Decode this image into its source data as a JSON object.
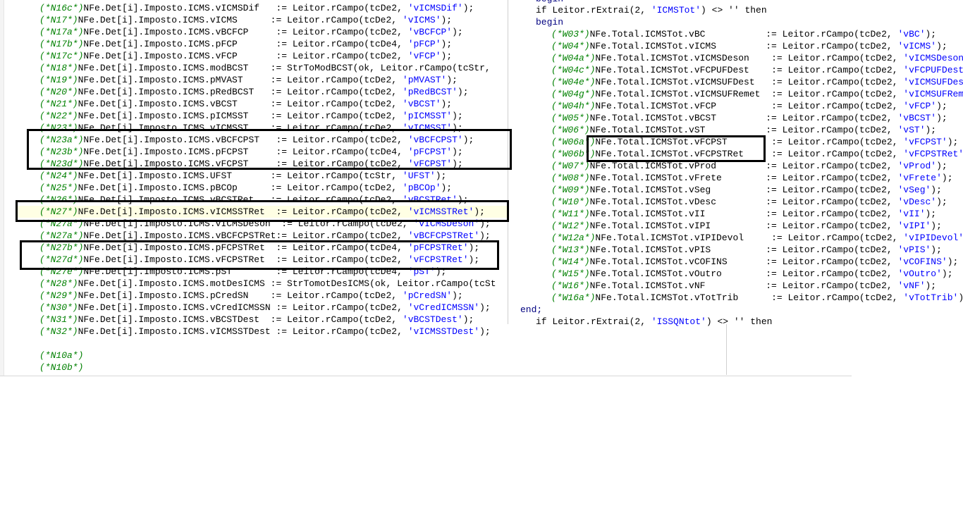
{
  "left_editor": {
    "lines": [
      {
        "t": 3,
        "c": "(*N16c*)",
        "p": "NFe.Det[i].Imposto.ICMS.vICMSDif   := Leitor.rCampo(tcDe2, ",
        "s": "'vICMSDif'",
        "e": ");"
      },
      {
        "t": 20,
        "c": "(*N17*)",
        "p": "NFe.Det[i].Imposto.ICMS.vICMS      := Leitor.rCampo(tcDe2, ",
        "s": "'vICMS'",
        "e": ");"
      },
      {
        "t": 37,
        "c": "(*N17a*)",
        "p": "NFe.Det[i].Imposto.ICMS.vBCFCP     := Leitor.rCampo(tcDe2, ",
        "s": "'vBCFCP'",
        "e": ");"
      },
      {
        "t": 54,
        "c": "(*N17b*)",
        "p": "NFe.Det[i].Imposto.ICMS.pFCP       := Leitor.rCampo(tcDe4, ",
        "s": "'pFCP'",
        "e": ");"
      },
      {
        "t": 71,
        "c": "(*N17c*)",
        "p": "NFe.Det[i].Imposto.ICMS.vFCP       := Leitor.rCampo(tcDe2, ",
        "s": "'vFCP'",
        "e": ");"
      },
      {
        "t": 88,
        "c": "(*N18*)",
        "p": "NFe.Det[i].Imposto.ICMS.modBCST    := StrToModBCST(ok, Leitor.rCampo(tcStr,",
        "s": "",
        "e": ""
      },
      {
        "t": 105,
        "c": "(*N19*)",
        "p": "NFe.Det[i].Imposto.ICMS.pMVAST     := Leitor.rCampo(tcDe2, ",
        "s": "'pMVAST'",
        "e": ");"
      },
      {
        "t": 122,
        "c": "(*N20*)",
        "p": "NFe.Det[i].Imposto.ICMS.pRedBCST   := Leitor.rCampo(tcDe2, ",
        "s": "'pRedBCST'",
        "e": ");"
      },
      {
        "t": 139,
        "c": "(*N21*)",
        "p": "NFe.Det[i].Imposto.ICMS.vBCST      := Leitor.rCampo(tcDe2, ",
        "s": "'vBCST'",
        "e": ");"
      },
      {
        "t": 156,
        "c": "(*N22*)",
        "p": "NFe.Det[i].Imposto.ICMS.pICMSST    := Leitor.rCampo(tcDe2, ",
        "s": "'pICMSST'",
        "e": ");"
      },
      {
        "t": 173,
        "c": "(*N23*)",
        "p": "NFe.Det[i].Imposto.ICMS.vICMSST    := Leitor.rCampo(tcDe2, ",
        "s": "'vICMSST'",
        "e": ");"
      },
      {
        "t": 190,
        "c": "(*N23a*)",
        "p": "NFe.Det[i].Imposto.ICMS.vBCFCPST   := Leitor.rCampo(tcDe2, ",
        "s": "'vBCFCPST'",
        "e": ");"
      },
      {
        "t": 207,
        "c": "(*N23b*)",
        "p": "NFe.Det[i].Imposto.ICMS.pFCPST     := Leitor.rCampo(tcDe4, ",
        "s": "'pFCPST'",
        "e": ");"
      },
      {
        "t": 224,
        "c": "(*N23d*)",
        "p": "NFe.Det[i].Imposto.ICMS.vFCPST     := Leitor.rCampo(tcDe2, ",
        "s": "'vFCPST'",
        "e": ");"
      },
      {
        "t": 241,
        "c": "(*N24*)",
        "p": "NFe.Det[i].Imposto.ICMS.UFST       := Leitor.rCampo(tcStr, ",
        "s": "'UFST'",
        "e": ");"
      },
      {
        "t": 258,
        "c": "(*N25*)",
        "p": "NFe.Det[i].Imposto.ICMS.pBCOp      := Leitor.rCampo(tcDe2, ",
        "s": "'pBCOp'",
        "e": ");"
      },
      {
        "t": 275,
        "c": "(*N26*)",
        "p": "NFe.Det[i].Imposto.ICMS.vBCSTRet   := Leitor.rCampo(tcDe2, ",
        "s": "'vBCSTRet'",
        "e": ");"
      },
      {
        "t": 292,
        "c": "(*N27*)",
        "p": "NFe.Det[i].Imposto.ICMS.vICMSSTRet  := Leitor.rCampo(tcDe2, ",
        "s": "'vICMSSTRet'",
        "e": ");",
        "hl": true
      },
      {
        "t": 309,
        "c": "(*N27a*)",
        "p": "NFe.Det[i].Imposto.ICMS.vICMSDeson  := Leitor.rCampo(tcDe2, ",
        "s": "'vICMSDeson'",
        "e": ");"
      },
      {
        "t": 326,
        "c": "(*N27a*)",
        "p": "NFe.Det[i].Imposto.ICMS.vBCFCPSTRet:= Leitor.rCampo(tcDe2, ",
        "s": "'vBCFCPSTRet'",
        "e": ");"
      },
      {
        "t": 343,
        "c": "(*N27b*)",
        "p": "NFe.Det[i].Imposto.ICMS.pFCPSTRet  := Leitor.rCampo(tcDe4, ",
        "s": "'pFCPSTRet'",
        "e": ");"
      },
      {
        "t": 360,
        "c": "(*N27d*)",
        "p": "NFe.Det[i].Imposto.ICMS.vFCPSTRet  := Leitor.rCampo(tcDe2, ",
        "s": "'vFCPSTRet'",
        "e": ");"
      },
      {
        "t": 377,
        "c": "(*N27e*)",
        "p": "NFe.Det[i].Imposto.ICMS.pST        := Leitor.rCampo(tcDe4, ",
        "s": "'pST'",
        "e": ");"
      },
      {
        "t": 394,
        "c": "(*N28*)",
        "p": "NFe.Det[i].Imposto.ICMS.motDesICMS := StrTomotDesICMS(ok, Leitor.rCampo(tcSt",
        "s": "",
        "e": ""
      },
      {
        "t": 411,
        "c": "(*N29*)",
        "p": "NFe.Det[i].Imposto.ICMS.pCredSN    := Leitor.rCampo(tcDe2, ",
        "s": "'pCredSN'",
        "e": ");"
      },
      {
        "t": 428,
        "c": "(*N30*)",
        "p": "NFe.Det[i].Imposto.ICMS.vCredICMSSN := Leitor.rCampo(tcDe2, ",
        "s": "'vCredICMSSN'",
        "e": ");"
      },
      {
        "t": 445,
        "c": "(*N31*)",
        "p": "NFe.Det[i].Imposto.ICMS.vBCSTDest  := Leitor.rCampo(tcDe2, ",
        "s": "'vBCSTDest'",
        "e": ");"
      },
      {
        "t": 462,
        "c": "(*N32*)",
        "p": "NFe.Det[i].Imposto.ICMS.vICMSSTDest := Leitor.rCampo(tcDe2, ",
        "s": "'vICMSSTDest'",
        "e": ");"
      },
      {
        "t": 496,
        "c": "(*N10a*)",
        "p": "",
        "s": "",
        "e": ""
      },
      {
        "t": 513,
        "c": "(*N10b*)",
        "p": "",
        "s": "",
        "e": ""
      }
    ]
  },
  "right_editor": {
    "lines": [
      {
        "t": -10,
        "i": 1,
        "p": "begin"
      },
      {
        "t": 6,
        "i": 1,
        "p": "if Leitor.rExtrai(2, ",
        "s": "'ICMSTot'",
        "e": ") <> '' then"
      },
      {
        "t": 23,
        "i": 1,
        "p": "begin"
      },
      {
        "t": 40,
        "i": 2,
        "c": "(*W03*)",
        "p": "NFe.Total.ICMSTot.vBC           := Leitor.rCampo(tcDe2, ",
        "s": "'vBC'",
        "e": ");"
      },
      {
        "t": 57,
        "i": 2,
        "c": "(*W04*)",
        "p": "NFe.Total.ICMSTot.vICMS         := Leitor.rCampo(tcDe2, ",
        "s": "'vICMS'",
        "e": ");"
      },
      {
        "t": 74,
        "i": 2,
        "c": "(*W04a*)",
        "p": "NFe.Total.ICMSTot.vICMSDeson    := Leitor.rCampo(tcDe2, ",
        "s": "'vICMSDeson'",
        "e": ");"
      },
      {
        "t": 91,
        "i": 2,
        "c": "(*W04c*)",
        "p": "NFe.Total.ICMSTot.vFCPUFDest    := Leitor.rCampo(tcDe2, ",
        "s": "'vFCPUFDest'",
        "e": ");"
      },
      {
        "t": 108,
        "i": 2,
        "c": "(*W04e*)",
        "p": "NFe.Total.ICMSTot.vICMSUFDest   := Leitor.rCampo(tcDe2, ",
        "s": "'vICMSUFDest'",
        "e": ");"
      },
      {
        "t": 125,
        "i": 2,
        "c": "(*W04g*)",
        "p": "NFe.Total.ICMSTot.vICMSUFRemet  := Leitor.rCampo(tcDe2, ",
        "s": "'vICMSUFRemet'",
        "e": ");"
      },
      {
        "t": 142,
        "i": 2,
        "c": "(*W04h*)",
        "p": "NFe.Total.ICMSTot.vFCP          := Leitor.rCampo(tcDe2, ",
        "s": "'vFCP'",
        "e": ");"
      },
      {
        "t": 159,
        "i": 2,
        "c": "(*W05*)",
        "p": "NFe.Total.ICMSTot.vBCST         := Leitor.rCampo(tcDe2, ",
        "s": "'vBCST'",
        "e": ");"
      },
      {
        "t": 176,
        "i": 2,
        "c": "(*W06*)",
        "p": "NFe.Total.ICMSTot.vST           := Leitor.rCampo(tcDe2, ",
        "s": "'vST'",
        "e": ");"
      },
      {
        "t": 193,
        "i": 2,
        "c": "(*W06a*)",
        "p": "NFe.Total.ICMSTot.vFCPST        := Leitor.rCampo(tcDe2, ",
        "s": "'vFCPST'",
        "e": ");"
      },
      {
        "t": 210,
        "i": 2,
        "c": "(*W06b*)",
        "p": "NFe.Total.ICMSTot.vFCPSTRet     := Leitor.rCampo(tcDe2, ",
        "s": "'vFCPSTRet'",
        "e": ");"
      },
      {
        "t": 227,
        "i": 2,
        "c": "(*W07*)",
        "p": "NFe.Total.ICMSTot.vProd         := Leitor.rCampo(tcDe2, ",
        "s": "'vProd'",
        "e": ");"
      },
      {
        "t": 244,
        "i": 2,
        "c": "(*W08*)",
        "p": "NFe.Total.ICMSTot.vFrete        := Leitor.rCampo(tcDe2, ",
        "s": "'vFrete'",
        "e": ");"
      },
      {
        "t": 261,
        "i": 2,
        "c": "(*W09*)",
        "p": "NFe.Total.ICMSTot.vSeg          := Leitor.rCampo(tcDe2, ",
        "s": "'vSeg'",
        "e": ");"
      },
      {
        "t": 278,
        "i": 2,
        "c": "(*W10*)",
        "p": "NFe.Total.ICMSTot.vDesc         := Leitor.rCampo(tcDe2, ",
        "s": "'vDesc'",
        "e": ");"
      },
      {
        "t": 295,
        "i": 2,
        "c": "(*W11*)",
        "p": "NFe.Total.ICMSTot.vII           := Leitor.rCampo(tcDe2, ",
        "s": "'vII'",
        "e": ");"
      },
      {
        "t": 312,
        "i": 2,
        "c": "(*W12*)",
        "p": "NFe.Total.ICMSTot.vIPI          := Leitor.rCampo(tcDe2, ",
        "s": "'vIPI'",
        "e": ");"
      },
      {
        "t": 329,
        "i": 2,
        "c": "(*W12a*)",
        "p": "NFe.Total.ICMSTot.vIPIDevol     := Leitor.rCampo(tcDe2, ",
        "s": "'vIPIDevol'",
        "e": ");"
      },
      {
        "t": 346,
        "i": 2,
        "c": "(*W13*)",
        "p": "NFe.Total.ICMSTot.vPIS          := Leitor.rCampo(tcDe2, ",
        "s": "'vPIS'",
        "e": ");"
      },
      {
        "t": 363,
        "i": 2,
        "c": "(*W14*)",
        "p": "NFe.Total.ICMSTot.vCOFINS       := Leitor.rCampo(tcDe2, ",
        "s": "'vCOFINS'",
        "e": ");"
      },
      {
        "t": 380,
        "i": 2,
        "c": "(*W15*)",
        "p": "NFe.Total.ICMSTot.vOutro        := Leitor.rCampo(tcDe2, ",
        "s": "'vOutro'",
        "e": ");"
      },
      {
        "t": 397,
        "i": 2,
        "c": "(*W16*)",
        "p": "NFe.Total.ICMSTot.vNF           := Leitor.rCampo(tcDe2, ",
        "s": "'vNF'",
        "e": ");"
      },
      {
        "t": 414,
        "i": 2,
        "c": "(*W16a*)",
        "p": "NFe.Total.ICMSTot.vTotTrib      := Leitor.rCampo(tcDe2, ",
        "s": "'vTotTrib'",
        "e": ");"
      },
      {
        "t": 431,
        "i": 0,
        "p": "end;"
      },
      {
        "t": 448,
        "i": 1,
        "p": "if Leitor.rExtrai(2, ",
        "s": "'ISSQNtot'",
        "e": ") <> '' then"
      }
    ]
  }
}
